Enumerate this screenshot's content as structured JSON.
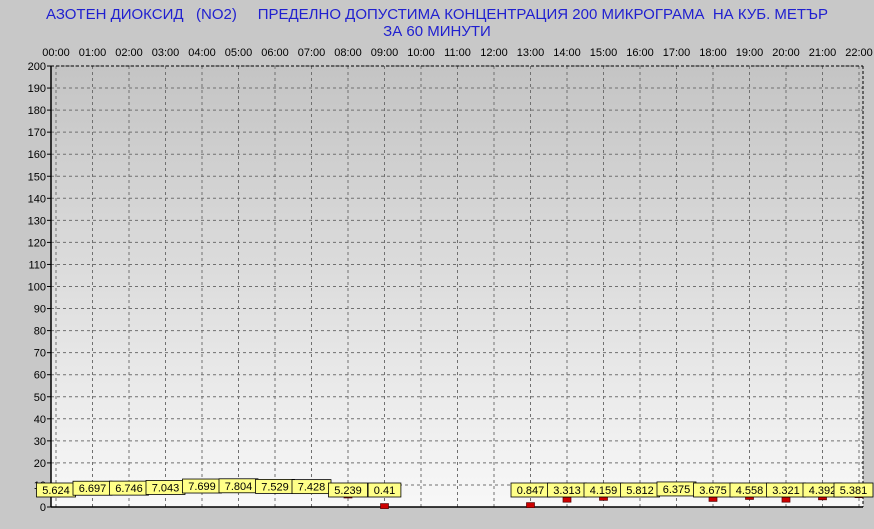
{
  "title_line1": "АЗОТЕН ДИОКСИД   (NO2)     ПРЕДЕЛНО ДОПУСТИМА КОНЦЕНТРАЦИЯ 200 МИКРОГРАМА  НА КУБ. МЕТЪР",
  "title_line2": "ЗА 60 МИНУТИ",
  "colors": {
    "background": "#c8c8c8",
    "plot_top": "#c4c4c4",
    "plot_bottom": "#f8f8f8",
    "title": "#2020d0",
    "marker": "#cc0000",
    "label_fill": "#ffff88",
    "grid": "#707070"
  },
  "chart_data": {
    "type": "line",
    "title": "АЗОТЕН ДИОКСИД   (NO2)     ПРЕДЕЛНО ДОПУСТИМА КОНЦЕНТРАЦИЯ 200 МИКРОГРАМА  НА КУБ. МЕТЪР ЗА 60 МИНУТИ",
    "x_tick_labels": [
      "00:00",
      "01:00",
      "02:00",
      "03:00",
      "04:00",
      "05:00",
      "06:00",
      "07:00",
      "08:00",
      "09:00",
      "10:00",
      "11:00",
      "12:00",
      "13:00",
      "14:00",
      "15:00",
      "16:00",
      "17:00",
      "18:00",
      "19:00",
      "20:00",
      "21:00",
      "22:00"
    ],
    "y_ticks": [
      0,
      10,
      20,
      30,
      40,
      50,
      60,
      70,
      80,
      90,
      100,
      110,
      120,
      130,
      140,
      150,
      160,
      170,
      180,
      190,
      200
    ],
    "ylim": [
      0,
      200
    ],
    "grid": true,
    "x_axis_position": "top",
    "points": [
      {
        "hour": 0,
        "value": 5.624,
        "label": "5.624"
      },
      {
        "hour": 1,
        "value": 6.697,
        "label": "6.697"
      },
      {
        "hour": 2,
        "value": 6.746,
        "label": "6.746"
      },
      {
        "hour": 3,
        "value": 7.043,
        "label": "7.043"
      },
      {
        "hour": 4,
        "value": 7.699,
        "label": "7.699"
      },
      {
        "hour": 5,
        "value": 7.804,
        "label": "7.804"
      },
      {
        "hour": 6,
        "value": 7.529,
        "label": "7.529"
      },
      {
        "hour": 7,
        "value": 7.428,
        "label": "7.428"
      },
      {
        "hour": 8,
        "value": 5.239,
        "label": "5.239"
      },
      {
        "hour": 9,
        "value": 0.41,
        "label": "0.41"
      },
      {
        "hour": 13,
        "value": 0.847,
        "label": "0.847"
      },
      {
        "hour": 14,
        "value": 3.313,
        "label": "3.313"
      },
      {
        "hour": 15,
        "value": 4.159,
        "label": "4.159"
      },
      {
        "hour": 16,
        "value": 5.812,
        "label": "5.812"
      },
      {
        "hour": 17,
        "value": 6.375,
        "label": "6.375"
      },
      {
        "hour": 18,
        "value": 3.675,
        "label": "3.675"
      },
      {
        "hour": 19,
        "value": 4.558,
        "label": "4.558"
      },
      {
        "hour": 20,
        "value": 3.321,
        "label": "3.321"
      },
      {
        "hour": 21,
        "value": 4.392,
        "label": "4.392"
      },
      {
        "hour": 22,
        "value": 5.381,
        "label": "5.381"
      }
    ]
  }
}
